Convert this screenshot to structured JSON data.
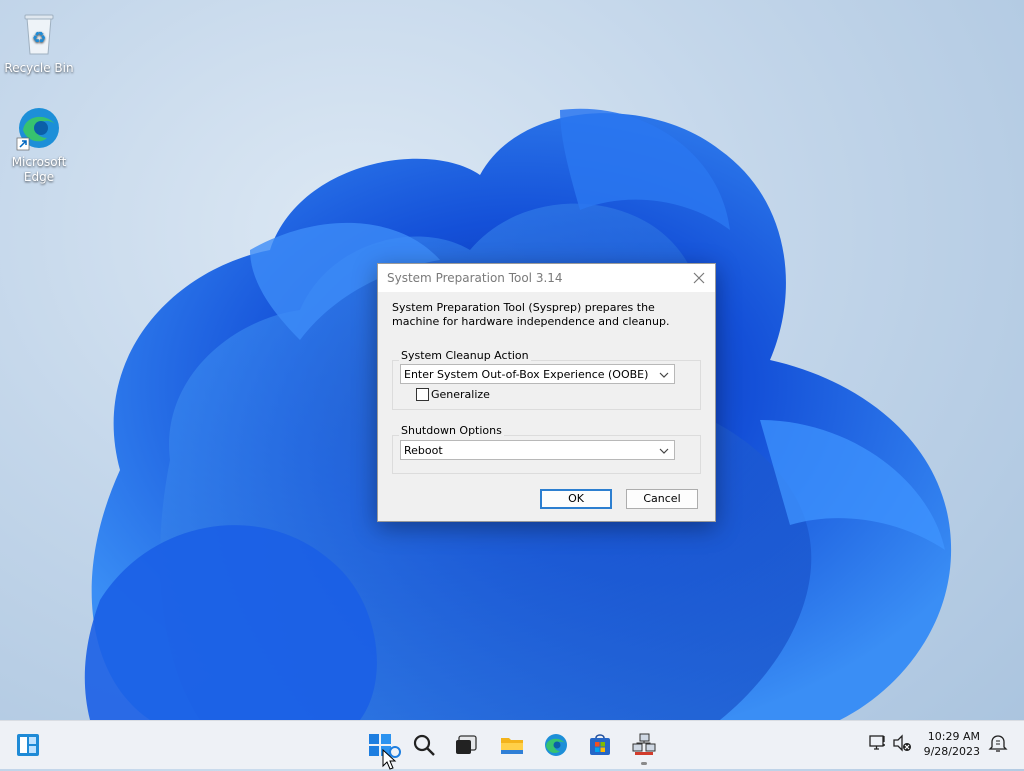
{
  "desktop": {
    "icons": [
      {
        "label": "Recycle Bin"
      },
      {
        "label": "Microsoft\nEdge"
      }
    ]
  },
  "dialog": {
    "title": "System Preparation Tool 3.14",
    "description": "System Preparation Tool (Sysprep) prepares the machine for hardware independence and cleanup.",
    "cleanup_group_label": "System Cleanup Action",
    "cleanup_selected": "Enter System Out-of-Box Experience (OOBE)",
    "generalize_label": "Generalize",
    "generalize_checked": false,
    "shutdown_group_label": "Shutdown Options",
    "shutdown_selected": "Reboot",
    "ok_label": "OK",
    "cancel_label": "Cancel"
  },
  "taskbar": {
    "time": "10:29 AM",
    "date": "9/28/2023",
    "icons": [
      "widgets-icon",
      "start-icon",
      "search-icon",
      "task-view-icon",
      "file-explorer-icon",
      "edge-icon",
      "store-icon",
      "sysprep-app-icon",
      "network-icon",
      "volume-muted-icon",
      "notification-icon"
    ]
  },
  "colors": {
    "accent": "#0067c0",
    "wallpaper_blue": "#1f6be0",
    "taskbar_bg": "#eef1f6",
    "dialog_bg": "#f0f0f0"
  }
}
